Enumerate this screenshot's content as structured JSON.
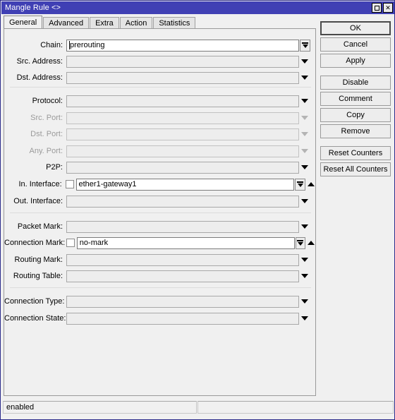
{
  "window": {
    "title": "Mangle Rule <>",
    "controls": [
      {
        "name": "maximize",
        "glyph": "□"
      },
      {
        "name": "close",
        "glyph": "✕"
      }
    ]
  },
  "tabs": [
    {
      "label": "General",
      "active": true
    },
    {
      "label": "Advanced",
      "active": false
    },
    {
      "label": "Extra",
      "active": false
    },
    {
      "label": "Action",
      "active": false
    },
    {
      "label": "Statistics",
      "active": false
    }
  ],
  "fields": [
    {
      "label": "Chain:",
      "value": "prerouting",
      "placeholder": "",
      "disabled": false,
      "filled": true,
      "caret": true,
      "checkbox": false,
      "control": "boxed-dropdown",
      "negate": false
    },
    {
      "label": "Src. Address:",
      "value": "",
      "placeholder": "",
      "disabled": false,
      "filled": false,
      "caret": false,
      "checkbox": false,
      "control": "triangle",
      "negate": false
    },
    {
      "label": "Dst. Address:",
      "value": "",
      "placeholder": "",
      "disabled": false,
      "filled": false,
      "caret": false,
      "checkbox": false,
      "control": "triangle",
      "negate": false
    },
    {
      "label": "Protocol:",
      "value": "",
      "placeholder": "",
      "disabled": false,
      "filled": false,
      "caret": false,
      "checkbox": false,
      "control": "triangle",
      "negate": false
    },
    {
      "label": "Src. Port:",
      "value": "",
      "placeholder": "",
      "disabled": true,
      "filled": false,
      "caret": false,
      "checkbox": false,
      "control": "triangle-disabled",
      "negate": false
    },
    {
      "label": "Dst. Port:",
      "value": "",
      "placeholder": "",
      "disabled": true,
      "filled": false,
      "caret": false,
      "checkbox": false,
      "control": "triangle-disabled",
      "negate": false
    },
    {
      "label": "Any. Port:",
      "value": "",
      "placeholder": "",
      "disabled": true,
      "filled": false,
      "caret": false,
      "checkbox": false,
      "control": "triangle-disabled",
      "negate": false
    },
    {
      "label": "P2P:",
      "value": "",
      "placeholder": "",
      "disabled": false,
      "filled": false,
      "caret": false,
      "checkbox": false,
      "control": "triangle",
      "negate": false
    },
    {
      "label": "In. Interface:",
      "value": "ether1-gateway1",
      "placeholder": "",
      "disabled": false,
      "filled": true,
      "caret": false,
      "checkbox": true,
      "control": "boxed-dropdown",
      "negate": true
    },
    {
      "label": "Out. Interface:",
      "value": "",
      "placeholder": "",
      "disabled": false,
      "filled": false,
      "caret": false,
      "checkbox": false,
      "control": "triangle",
      "negate": false
    },
    {
      "label": "Packet Mark:",
      "value": "",
      "placeholder": "",
      "disabled": false,
      "filled": false,
      "caret": false,
      "checkbox": false,
      "control": "triangle",
      "negate": false
    },
    {
      "label": "Connection Mark:",
      "value": "no-mark",
      "placeholder": "",
      "disabled": false,
      "filled": true,
      "caret": false,
      "checkbox": true,
      "control": "boxed-dropdown",
      "negate": true
    },
    {
      "label": "Routing Mark:",
      "value": "",
      "placeholder": "",
      "disabled": false,
      "filled": false,
      "caret": false,
      "checkbox": false,
      "control": "triangle",
      "negate": false
    },
    {
      "label": "Routing Table:",
      "value": "",
      "placeholder": "",
      "disabled": false,
      "filled": false,
      "caret": false,
      "checkbox": false,
      "control": "triangle",
      "negate": false
    },
    {
      "label": "Connection Type:",
      "value": "",
      "placeholder": "",
      "disabled": false,
      "filled": false,
      "caret": false,
      "checkbox": false,
      "control": "triangle",
      "negate": false
    },
    {
      "label": "Connection State:",
      "value": "",
      "placeholder": "",
      "disabled": false,
      "filled": false,
      "caret": false,
      "checkbox": false,
      "control": "triangle",
      "negate": false
    }
  ],
  "buttons": [
    {
      "label": "OK",
      "default": true,
      "gap": false
    },
    {
      "label": "Cancel",
      "default": false,
      "gap": false
    },
    {
      "label": "Apply",
      "default": false,
      "gap": false
    },
    {
      "label": "Disable",
      "default": false,
      "gap": true
    },
    {
      "label": "Comment",
      "default": false,
      "gap": false
    },
    {
      "label": "Copy",
      "default": false,
      "gap": false
    },
    {
      "label": "Remove",
      "default": false,
      "gap": false
    },
    {
      "label": "Reset Counters",
      "default": false,
      "gap": true
    },
    {
      "label": "Reset All Counters",
      "default": false,
      "gap": false
    }
  ],
  "statusbar": {
    "left": "enabled",
    "right": ""
  },
  "colors": {
    "titlebar": "#4040b4",
    "titlebar_text": "#ffffff",
    "dialog_bg": "#f0f0f0",
    "field_bg": "#ededed",
    "field_bg_filled": "#ffffff",
    "label_disabled": "#9a9a9a"
  }
}
